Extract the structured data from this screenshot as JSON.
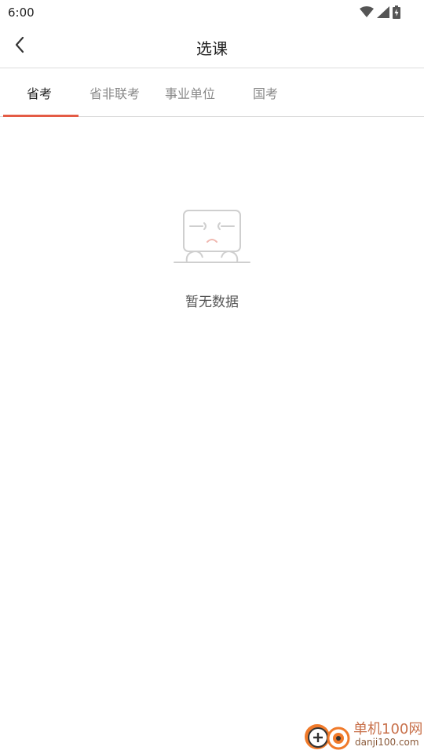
{
  "status_bar": {
    "time": "6:00",
    "icons": [
      "wifi-icon",
      "signal-icon",
      "battery-icon"
    ]
  },
  "header": {
    "back_icon": "back-arrow-icon",
    "title": "选课"
  },
  "tabs": [
    {
      "label": "省考",
      "active": true
    },
    {
      "label": "省非联考",
      "active": false
    },
    {
      "label": "事业单位",
      "active": false
    },
    {
      "label": "国考",
      "active": false
    }
  ],
  "empty_state": {
    "icon": "empty-box-icon",
    "text": "暂无数据"
  },
  "watermark": {
    "title": "单机100网",
    "url": "danji100.com"
  },
  "colors": {
    "accent": "#e45b45",
    "text_primary": "#222222",
    "text_secondary": "#888888",
    "divider": "#dcdcdc"
  }
}
